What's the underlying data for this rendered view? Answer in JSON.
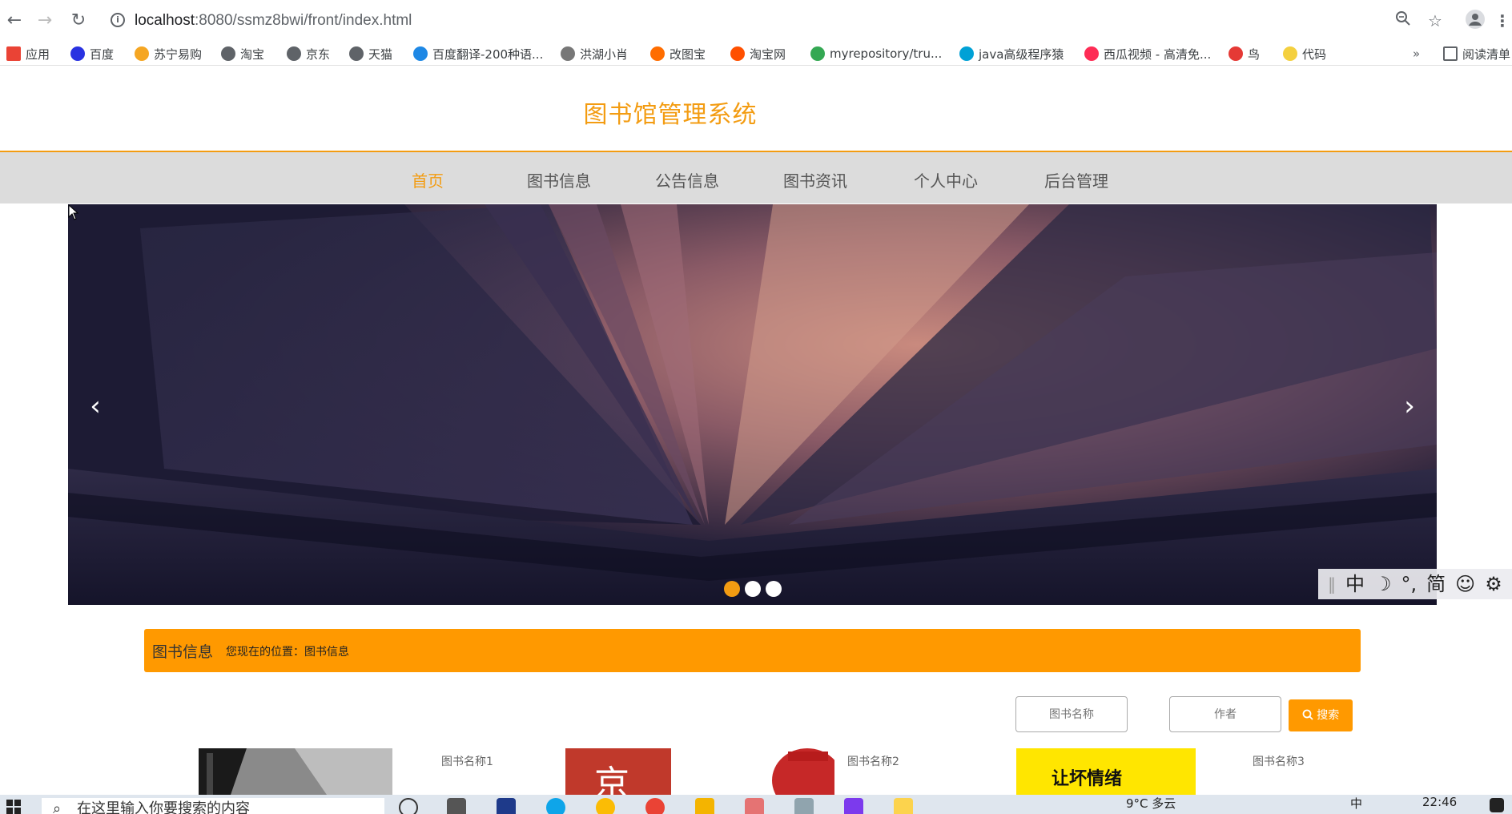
{
  "browser": {
    "url_host": "localhost",
    "url_path": ":8080/ssmz8bwi/front/index.html",
    "bookmarks": [
      {
        "label": "应用",
        "icon": "apps-grid-icon",
        "color": "#ea4335"
      },
      {
        "label": "百度",
        "icon": "baidu-icon",
        "color": "#2932e1"
      },
      {
        "label": "苏宁易购",
        "icon": "suning-icon",
        "color": "#f5a623"
      },
      {
        "label": "淘宝",
        "icon": "globe-icon",
        "color": "#5f6368"
      },
      {
        "label": "京东",
        "icon": "globe-icon",
        "color": "#5f6368"
      },
      {
        "label": "天猫",
        "icon": "globe-icon",
        "color": "#5f6368"
      },
      {
        "label": "百度翻译-200种语...",
        "icon": "translate-icon",
        "color": "#1e88e5"
      },
      {
        "label": "洪湖小肖",
        "icon": "feather-icon",
        "color": "#777777"
      },
      {
        "label": "改图宝",
        "icon": "gaitubao-icon",
        "color": "#ff6d00"
      },
      {
        "label": "淘宝网",
        "icon": "taobao-icon",
        "color": "#ff5000"
      },
      {
        "label": "myrepository/tru...",
        "icon": "chrome-icon",
        "color": "#34a853"
      },
      {
        "label": "java高级程序猿",
        "icon": "bilibili-icon",
        "color": "#00a1d6"
      },
      {
        "label": "西瓜视频 - 高清免...",
        "icon": "xigua-icon",
        "color": "#fe2c55"
      },
      {
        "label": "鸟",
        "icon": "bird-icon",
        "color": "#e53935"
      },
      {
        "label": "代码",
        "icon": "moon-icon",
        "color": "#f4d03f"
      }
    ],
    "more_label": "»",
    "reading_list_label": "阅读清单"
  },
  "site": {
    "title": "图书馆管理系统",
    "nav": [
      {
        "label": "首页",
        "active": true
      },
      {
        "label": "图书信息",
        "active": false
      },
      {
        "label": "公告信息",
        "active": false
      },
      {
        "label": "图书资讯",
        "active": false
      },
      {
        "label": "个人中心",
        "active": false
      },
      {
        "label": "后台管理",
        "active": false
      }
    ]
  },
  "carousel": {
    "prev_label": "‹",
    "next_label": "›",
    "slide_count": 3,
    "active_slide": 1
  },
  "ime": {
    "items": [
      "中",
      "☽",
      "°,",
      "简",
      "☺",
      "⚙"
    ]
  },
  "section": {
    "title": "图书信息",
    "location": "您现在的位置：图书信息"
  },
  "search": {
    "name_placeholder": "图书名称",
    "author_placeholder": "作者",
    "button_label": "搜索"
  },
  "books": [
    {
      "name": "图书名称1"
    },
    {
      "name": "图书名称2"
    },
    {
      "name": "图书名称3"
    }
  ],
  "book_cover_texts": {
    "cover2_char": "京",
    "cover3_text": "让坏情绪"
  },
  "taskbar": {
    "search_placeholder": "在这里输入你要搜索的内容",
    "weather": "9°C 多云",
    "time": "22:46",
    "ime_label": "中"
  }
}
